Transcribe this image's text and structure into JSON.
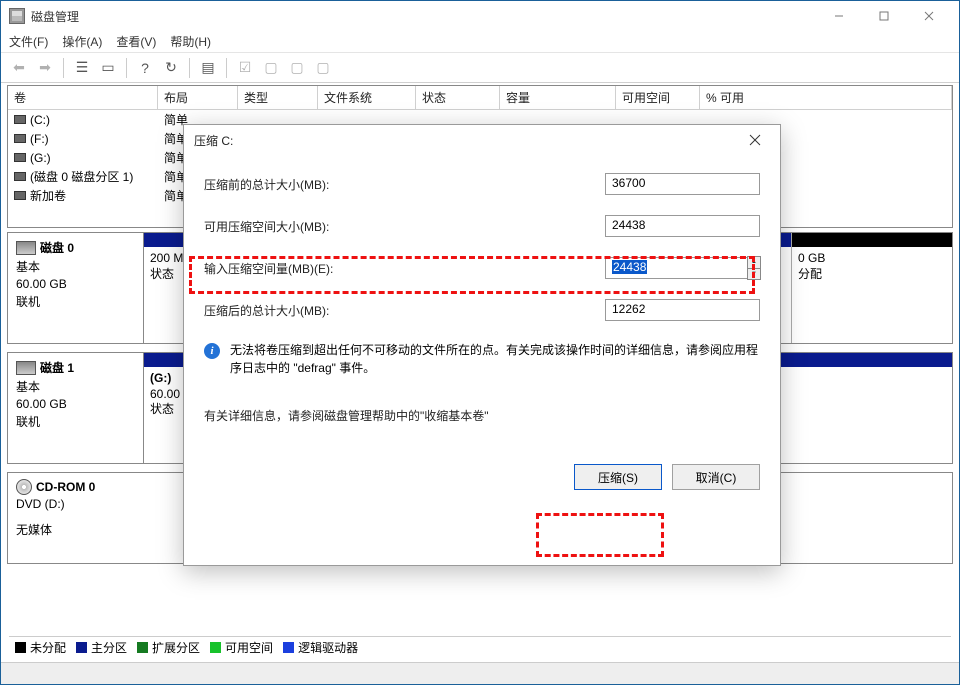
{
  "window": {
    "title": "磁盘管理"
  },
  "menu": {
    "file": "文件(F)",
    "action": "操作(A)",
    "view": "查看(V)",
    "help": "帮助(H)"
  },
  "grid": {
    "headers": {
      "volume": "卷",
      "layout": "布局",
      "type": "类型",
      "fs": "文件系统",
      "status": "状态",
      "capacity": "容量",
      "free": "可用空间",
      "pct": "% 可用"
    },
    "rows": [
      {
        "vol": "(C:)",
        "layout": "简单"
      },
      {
        "vol": "(F:)",
        "layout": "简单"
      },
      {
        "vol": "(G:)",
        "layout": "简单"
      },
      {
        "vol": "(磁盘 0 磁盘分区 1)",
        "layout": "简单"
      },
      {
        "vol": "新加卷",
        "layout": "简单"
      }
    ]
  },
  "disks": {
    "d0": {
      "title": "磁盘 0",
      "type": "基本",
      "size": "60.00 GB",
      "state": "联机"
    },
    "d0_part1": {
      "size": "200 M",
      "stat": "状态"
    },
    "d0_part_right": {
      "size": "0 GB",
      "stat": "分配"
    },
    "d1": {
      "title": "磁盘 1",
      "type": "基本",
      "size": "60.00 GB",
      "state": "联机"
    },
    "d1_part1": {
      "name": "(G:)",
      "size": "60.00",
      "stat": "状态"
    },
    "cd": {
      "title": "CD-ROM 0",
      "sub": "DVD (D:)",
      "state": "无媒体"
    }
  },
  "legend": {
    "unalloc": "未分配",
    "primary": "主分区",
    "ext": "扩展分区",
    "free": "可用空间",
    "logical": "逻辑驱动器"
  },
  "dialog": {
    "title": "压缩 C:",
    "before_label": "压缩前的总计大小(MB):",
    "before_val": "36700",
    "avail_label": "可用压缩空间大小(MB):",
    "avail_val": "24438",
    "input_label": "输入压缩空间量(MB)(E):",
    "input_val": "24438",
    "after_label": "压缩后的总计大小(MB):",
    "after_val": "12262",
    "info": "无法将卷压缩到超出任何不可移动的文件所在的点。有关完成该操作时间的详细信息，请参阅应用程序日志中的 \"defrag\" 事件。",
    "help": "有关详细信息，请参阅磁盘管理帮助中的\"收缩基本卷\"",
    "shrink_btn": "压缩(S)",
    "cancel_btn": "取消(C)"
  }
}
